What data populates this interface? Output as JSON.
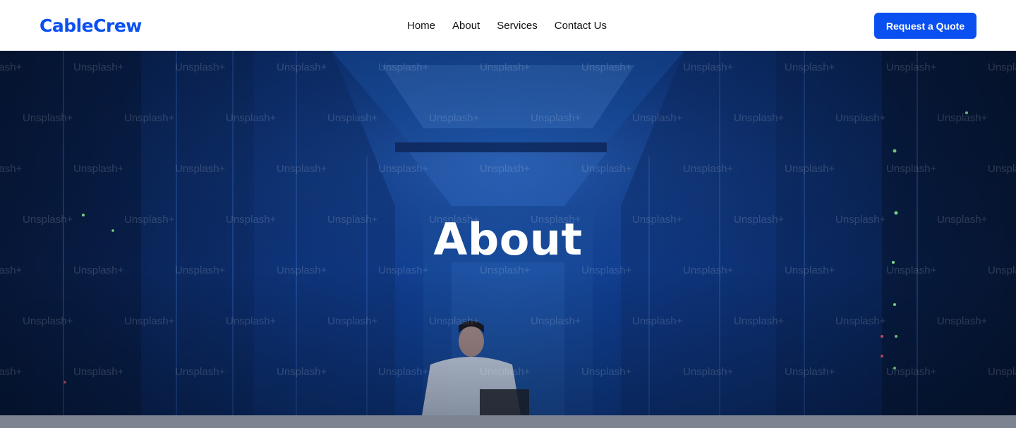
{
  "brand": {
    "name": "CableCrew",
    "color": "#0a4ff0"
  },
  "nav": {
    "links": [
      {
        "label": "Home"
      },
      {
        "label": "About"
      },
      {
        "label": "Services"
      },
      {
        "label": "Contact Us"
      }
    ],
    "cta_label": "Request a Quote",
    "cta_color": "#0a4ff0"
  },
  "hero": {
    "title": "About",
    "watermark": "Unsplash+",
    "image_description_icon": "server-room-photo"
  },
  "colors": {
    "hero_dark": "#061735",
    "hero_mid": "#12469e",
    "footer_strip": "#7d8391"
  }
}
